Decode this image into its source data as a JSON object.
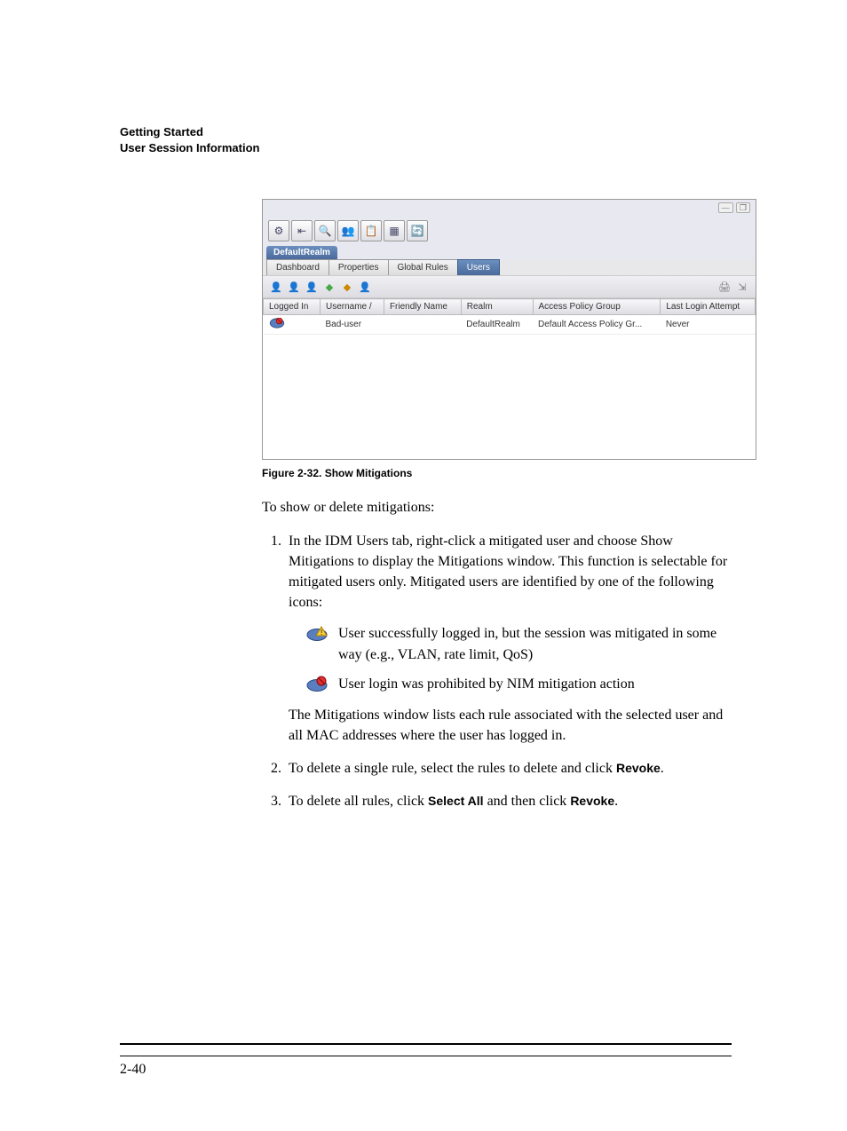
{
  "header": {
    "line1": "Getting Started",
    "line2": "User Session Information"
  },
  "screenshot": {
    "realm_tab": "DefaultRealm",
    "sub_tabs": [
      "Dashboard",
      "Properties",
      "Global Rules",
      "Users"
    ],
    "active_sub_tab": "Users",
    "columns": [
      "Logged In",
      "Username  /",
      "Friendly Name",
      "Realm",
      "Access Policy Group",
      "Last Login Attempt"
    ],
    "row": {
      "username": "Bad-user",
      "friendly": "",
      "realm": "DefaultRealm",
      "apg": "Default Access Policy Gr...",
      "last": "Never"
    },
    "toolbar_icons": [
      "preferences-icon",
      "back-icon",
      "find-icon",
      "users-icon",
      "report-icon",
      "grid-icon",
      "refresh-icon"
    ],
    "action_icons_left": [
      "user-yellow-icon",
      "user-grey-icon",
      "user-grey2-icon",
      "diamond-green-icon",
      "diamond-orange-icon",
      "user-config-icon"
    ],
    "action_icons_right": [
      "print-icon",
      "export-icon"
    ],
    "window_controls": [
      "minimize-icon",
      "restore-icon"
    ]
  },
  "figure_caption": "Figure 2-32. Show Mitigations",
  "intro": "To show or delete mitigations:",
  "steps": {
    "s1": "In the IDM Users tab, right-click a mitigated user and choose Show Mitigations to display the Mitigations window. This function is selectable for mitigated users only. Mitigated users are identified by one of the following icons:",
    "icon1": "User successfully logged in, but the session was mitigated in some way (e.g., VLAN, rate limit, QoS)",
    "icon2": "User login was prohibited by NIM mitigation action",
    "s1b": "The Mitigations window lists each rule associated with the selected user and all MAC addresses where the user has logged in.",
    "s2a": "To delete a single rule, select the rules to delete and click ",
    "s2b": "Revoke",
    "s2c": ".",
    "s3a": "To delete all rules, click ",
    "s3b": "Select All",
    "s3c": " and then click ",
    "s3d": "Revoke",
    "s3e": "."
  },
  "page_number": "2-40"
}
